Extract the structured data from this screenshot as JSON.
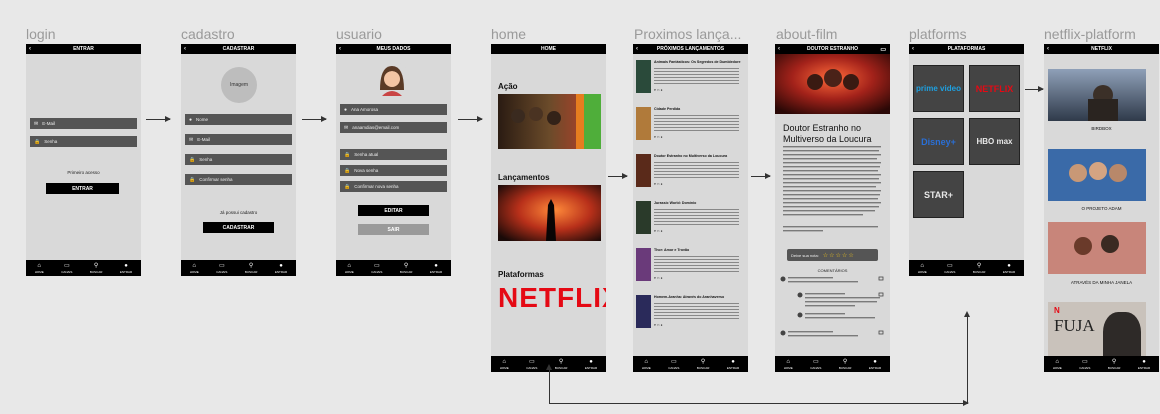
{
  "screens": {
    "login": {
      "label": "login",
      "header": "ENTRAR",
      "email_placeholder": "E-Mail",
      "password_placeholder": "Senha",
      "first_access": "Primeiro acesso",
      "submit": "ENTRAR"
    },
    "cadastro": {
      "label": "cadastro",
      "header": "CADASTRAR",
      "avatar_text": "Imagem",
      "fields": [
        "Nome",
        "E-Mail",
        "Senha",
        "Confirmar senha"
      ],
      "already": "Já possui cadastro",
      "submit": "CADASTRAR"
    },
    "usuario": {
      "label": "usuario",
      "header": "MEUS DADOS",
      "name": "Ana Amorosa",
      "email": "anaamdias@email.com",
      "fields": [
        "Senha atual",
        "Nova senha",
        "Confirmar nova senha"
      ],
      "edit": "EDITAR",
      "exit": "SAIR"
    },
    "home": {
      "label": "home",
      "header": "HOME",
      "sections": [
        "Ação",
        "Lançamentos",
        "Plataformas"
      ],
      "platform_logo": "NETFLIX"
    },
    "proximos": {
      "label": "Proximos lança...",
      "header": "PRÓXIMOS LANÇAMENTOS",
      "items": [
        "Animais Fantásticos: Os Segredos de Dumbledore",
        "Cidade Perdida",
        "Doutor Estranho no Multiverso da Loucura",
        "Jurassic World: Domínio",
        "Thor: Amor e Trovão",
        "Homem-Aranha: Através do Aranhaverso"
      ]
    },
    "about": {
      "label": "about-film",
      "header": "DOUTOR ESTRANHO",
      "title": "Doutor Estranho no Multiverso da Loucura",
      "rate_label": "Deixe sua nota:",
      "comments_title": "COMENTÁRIOS"
    },
    "platforms": {
      "label": "platforms",
      "header": "PLATAFORMAS",
      "tiles": [
        "prime video",
        "NETFLIX",
        "Disney+",
        "HBO max",
        "STAR+"
      ]
    },
    "netflix": {
      "label": "netflix-platform",
      "header": "NETFLIX",
      "movies": [
        "BIRDBOX",
        "O PROJETO ADAM",
        "ATRAVÉS DA MINHA JANELA",
        "FUJA"
      ]
    }
  },
  "nav": [
    "HOME",
    "CANAIS",
    "BUSCAR",
    "ENTRAR"
  ],
  "colors": {
    "netflix_red": "#e50914",
    "background": "#e8e8e8",
    "phone": "#d9d9d9"
  }
}
